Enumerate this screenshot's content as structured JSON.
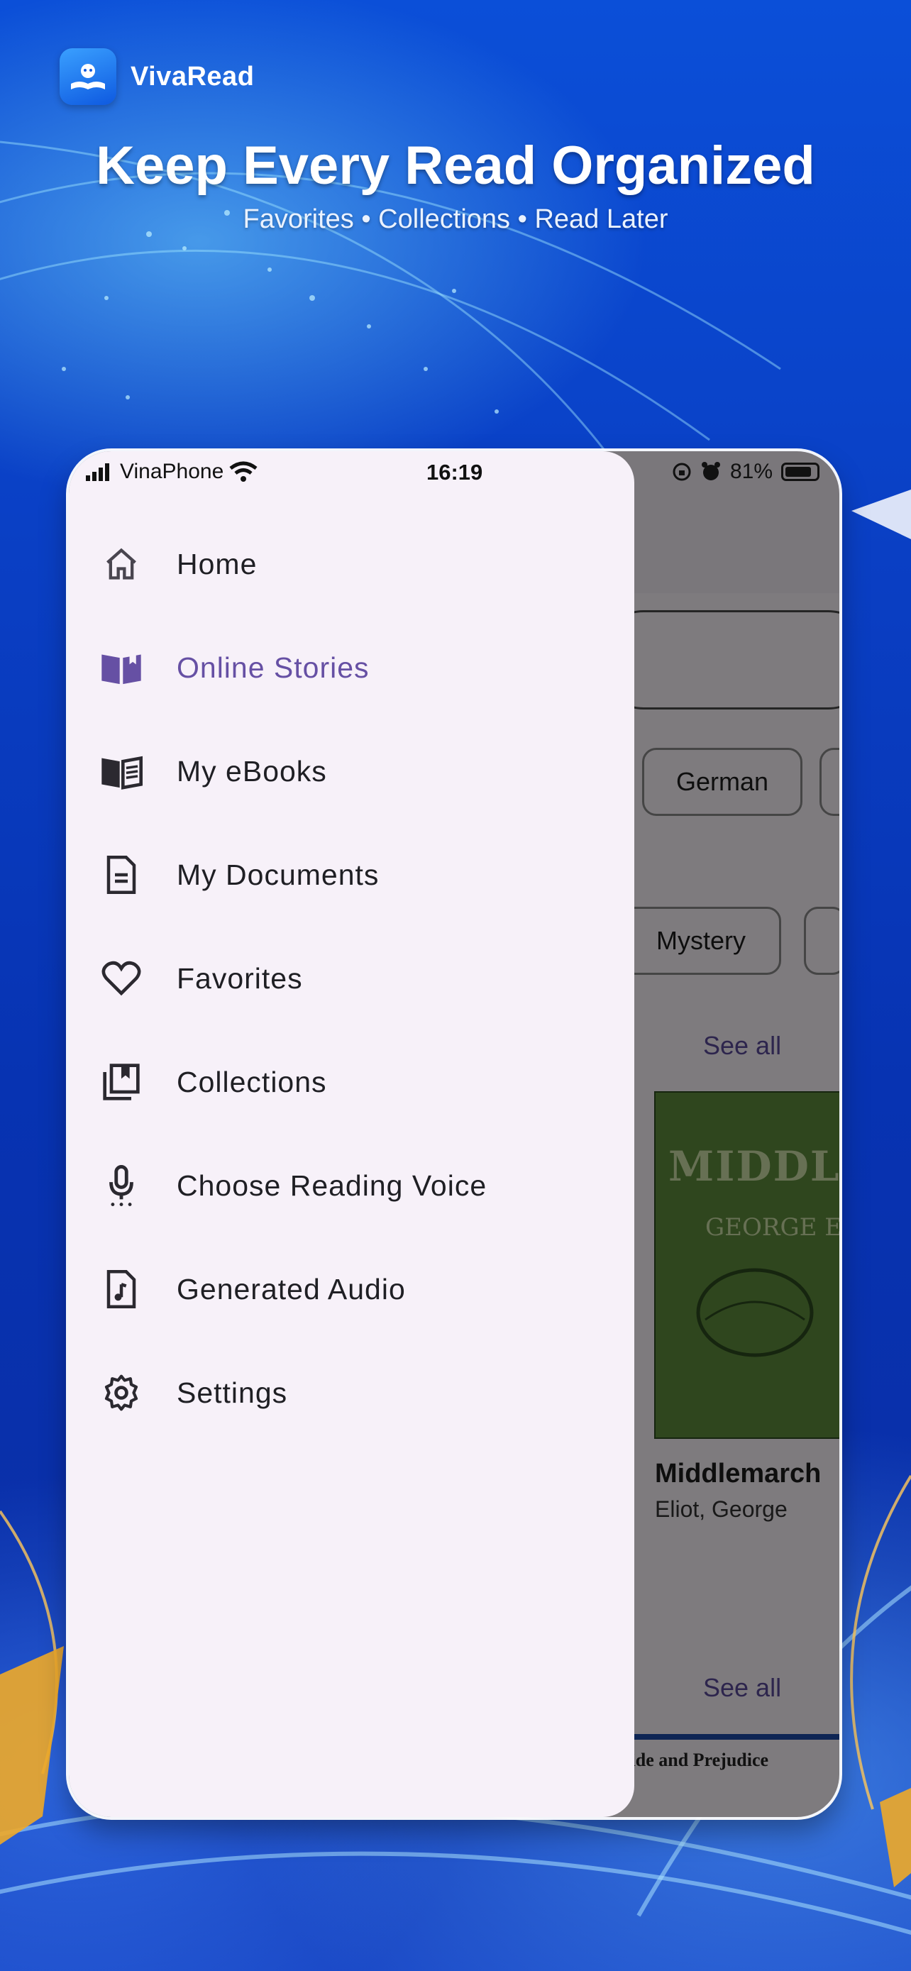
{
  "brand": {
    "name": "VivaRead"
  },
  "headline": "Keep Every Read Organized",
  "subline": "Favorites • Collections • Read Later",
  "status_bar": {
    "carrier": "VinaPhone",
    "time": "16:19",
    "battery": "81%"
  },
  "drawer": {
    "items": [
      {
        "label": "Home",
        "icon": "home-icon"
      },
      {
        "label": "Online Stories",
        "icon": "open-book-icon",
        "active": true
      },
      {
        "label": "My eBooks",
        "icon": "book-icon"
      },
      {
        "label": "My Documents",
        "icon": "document-icon"
      },
      {
        "label": "Favorites",
        "icon": "heart-icon"
      },
      {
        "label": "Collections",
        "icon": "bookmark-stack-icon"
      },
      {
        "label": "Choose Reading Voice",
        "icon": "microphone-icon"
      },
      {
        "label": "Generated Audio",
        "icon": "audio-file-icon"
      },
      {
        "label": "Settings",
        "icon": "gear-icon"
      }
    ],
    "active_color": "#6650a4"
  },
  "background_app": {
    "chips_row1": [
      "German"
    ],
    "chips_row2": [
      "Mystery"
    ],
    "see_all_label": "See all",
    "book": {
      "cover_title": "MIDDLEMAR",
      "cover_author": "GEORGE ELIOT",
      "title": "Middlemarch",
      "author": "Eliot, George"
    },
    "bottom_book": "ride and Prejudice"
  }
}
